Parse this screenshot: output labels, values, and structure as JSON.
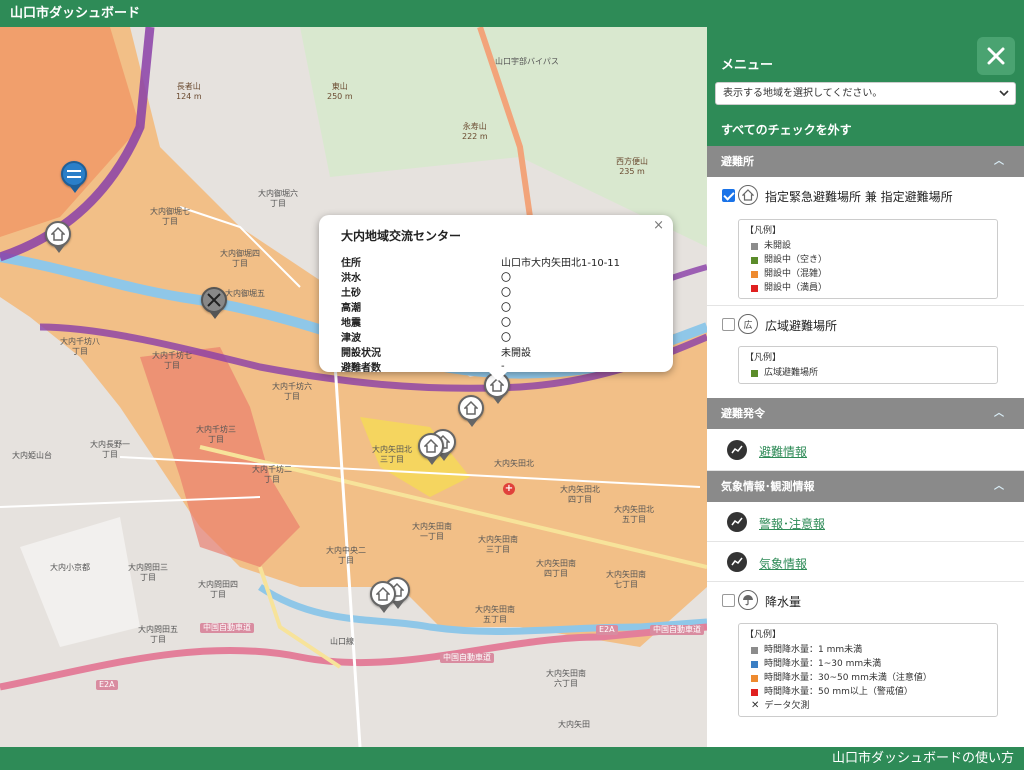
{
  "app": {
    "title": "山口市ダッシュボード",
    "help_link": "山口市ダッシュボードの使い方"
  },
  "map": {
    "labels": {
      "peak_nagamine": "長者山\n124 m",
      "peak_higashiyama": "東山\n250 m",
      "peak_eiju": "永寿山\n222 m",
      "peak_saiho": "西方便山\n235 m",
      "town_1": "大内御堀七\n丁目",
      "town_2": "大内御堀六\n丁目",
      "town_3": "大内御堀四\n丁目",
      "town_4": "大内御堀五",
      "town_5": "大内千坊八\n丁目",
      "town_6": "大内千坊七\n丁目",
      "town_7": "大内千坊六\n丁目",
      "town_8": "大内千坊三\n丁目",
      "town_9": "大内千坊二\n丁目",
      "town_10": "大内長野一\n丁目",
      "town_11": "大内姫山台",
      "town_12": "大内小京都",
      "town_13": "大内問田三\n丁目",
      "town_14": "大内問田四\n丁目",
      "town_15": "大内問田五\n丁目",
      "town_16": "大内中央二\n丁目",
      "town_17": "大内矢田北",
      "town_18": "大内矢田北\n四丁目",
      "town_19": "大内矢田北\n三丁目",
      "town_20": "大内矢田南\n一丁目",
      "town_21": "大内矢田南\n三丁目",
      "town_22": "大内矢田南\n四丁目",
      "town_23": "大内矢田南\n五丁目",
      "town_24": "大内矢田南\n六丁目",
      "town_25": "大内矢田北\n五丁目",
      "town_26": "大内矢田南\n七丁目",
      "town_27": "大内矢田",
      "road_expressway_1": "中国自動車道",
      "road_expressway_2": "中国自動車道",
      "road_expressway_3": "中国自動車道",
      "road_line": "山口線",
      "route_e2a_1": "E2A",
      "route_e2a_2": "E2A",
      "bypass": "山口宇部バイパス"
    }
  },
  "popup": {
    "title": "大内地域交流センター",
    "rows": [
      {
        "k": "住所",
        "v": "山口市大内矢田北1-10-11"
      },
      {
        "k": "洪水",
        "v": "〇"
      },
      {
        "k": "土砂",
        "v": "〇"
      },
      {
        "k": "高潮",
        "v": "〇"
      },
      {
        "k": "地震",
        "v": "〇"
      },
      {
        "k": "津波",
        "v": "〇"
      },
      {
        "k": "開設状況",
        "v": "未開設"
      },
      {
        "k": "避難者数",
        "v": "-"
      }
    ],
    "close": "×"
  },
  "sidebar": {
    "title": "メニュー",
    "area_select_placeholder": "表示する地域を選択してください。",
    "uncheck_all": "すべてのチェックを外す",
    "sections": {
      "evac": "避難所",
      "evac_order": "避難発令",
      "weather": "気象情報･観測情報"
    },
    "items": {
      "designated": "指定緊急避難場所 兼 指定避難場所",
      "wide_area": "広域避難場所",
      "evac_info": "避難情報",
      "warning": "警報･注意報",
      "weather_info": "気象情報",
      "rainfall": "降水量"
    },
    "legend_title": "【凡例】",
    "legend_designated": [
      {
        "label": "未開設",
        "color": "#8c8c8c"
      },
      {
        "label": "開設中（空き）",
        "color": "#5b8c2a"
      },
      {
        "label": "開設中（混雑）",
        "color": "#ee8a2f"
      },
      {
        "label": "開設中（満員）",
        "color": "#e02020"
      }
    ],
    "legend_wide": [
      {
        "label": "広域避難場所",
        "color": "#5b8c2a"
      }
    ],
    "legend_rain": [
      {
        "label": "時間降水量：1 mm未満",
        "color": "#8c8c8c"
      },
      {
        "label": "時間降水量：1~30 mm未満",
        "color": "#3b7fc4"
      },
      {
        "label": "時間降水量：30~50 mm未満（注意値）",
        "color": "#ee8a2f"
      },
      {
        "label": "時間降水量：50 mm以上（警戒値）",
        "color": "#e02020"
      }
    ],
    "legend_rain_missing": "データ欠測",
    "checks": {
      "designated": true,
      "wide_area": false,
      "rainfall": false
    }
  }
}
